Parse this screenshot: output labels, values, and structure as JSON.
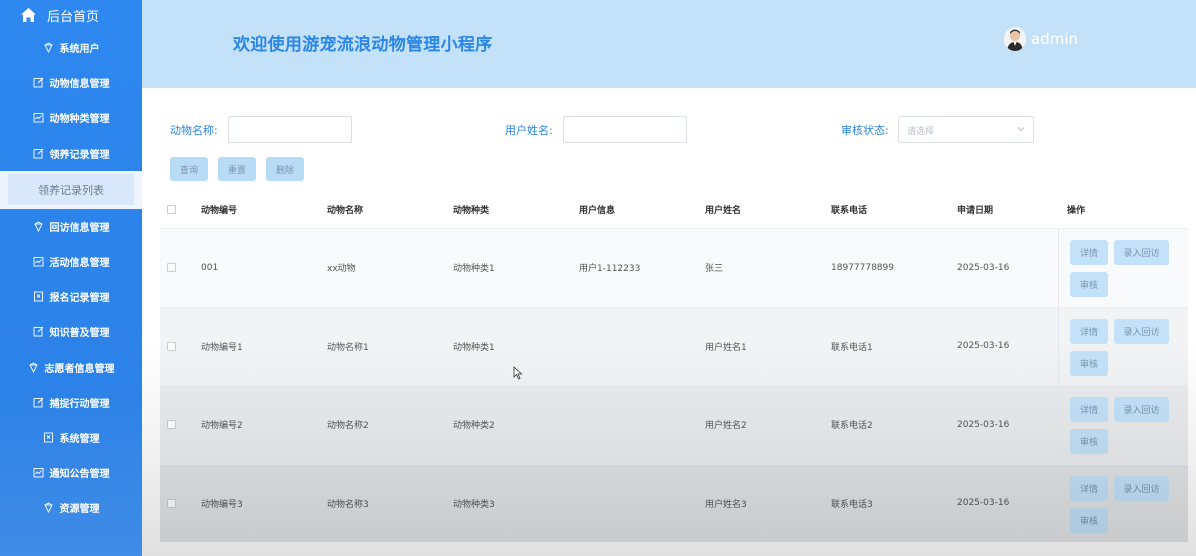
{
  "sidebar": {
    "home_label": "后台首页",
    "items": [
      {
        "label": "系统用户",
        "icon": "diamond-icon"
      },
      {
        "label": "动物信息管理",
        "icon": "edit-icon"
      },
      {
        "label": "动物种类管理",
        "icon": "chart-icon"
      },
      {
        "label": "领养记录管理",
        "icon": "edit-icon"
      },
      {
        "label": "领养记录列表",
        "icon": "",
        "sub": true
      },
      {
        "label": "回访信息管理",
        "icon": "diamond-icon"
      },
      {
        "label": "活动信息管理",
        "icon": "chart-icon"
      },
      {
        "label": "报名记录管理",
        "icon": "bookmark-icon"
      },
      {
        "label": "知识普及管理",
        "icon": "edit-icon"
      },
      {
        "label": "志愿者信息管理",
        "icon": "diamond-icon"
      },
      {
        "label": "捕捉行动管理",
        "icon": "edit-icon"
      },
      {
        "label": "系统管理",
        "icon": "bookmark-icon"
      },
      {
        "label": "通知公告管理",
        "icon": "chart-icon"
      },
      {
        "label": "资源管理",
        "icon": "diamond-icon"
      }
    ]
  },
  "header": {
    "title": "欢迎使用游宠流浪动物管理小程序",
    "username": "admin"
  },
  "filters": {
    "animal_name_label": "动物名称:",
    "user_name_label": "用户姓名:",
    "status_label": "审核状态:",
    "status_placeholder": "请选择"
  },
  "buttons": {
    "query": "查询",
    "reset": "重置",
    "delete": "删除"
  },
  "table": {
    "headers": [
      "动物编号",
      "动物名称",
      "动物种类",
      "用户信息",
      "用户姓名",
      "联系电话",
      "申请日期",
      "操作"
    ],
    "rows": [
      {
        "cells": [
          "001",
          "xx动物",
          "动物种类1",
          "用户1-112233",
          "张三",
          "18977778899",
          "2025-03-16"
        ]
      },
      {
        "cells": [
          "动物编号1",
          "动物名称1",
          "动物种类1",
          "",
          "用户姓名1",
          "联系电话1",
          "2025-03-16"
        ]
      },
      {
        "cells": [
          "动物编号2",
          "动物名称2",
          "动物种类2",
          "",
          "用户姓名2",
          "联系电话2",
          "2025-03-16"
        ]
      },
      {
        "cells": [
          "动物编号3",
          "动物名称3",
          "动物种类3",
          "",
          "用户姓名3",
          "联系电话3",
          "2025-03-16"
        ]
      }
    ],
    "actions": {
      "detail": "详情",
      "record_visit": "录入回访",
      "audit": "审核"
    }
  },
  "colors": {
    "sidebar": "#2e88f0",
    "header": "#c3e2fa",
    "accent": "#2b86e6"
  }
}
